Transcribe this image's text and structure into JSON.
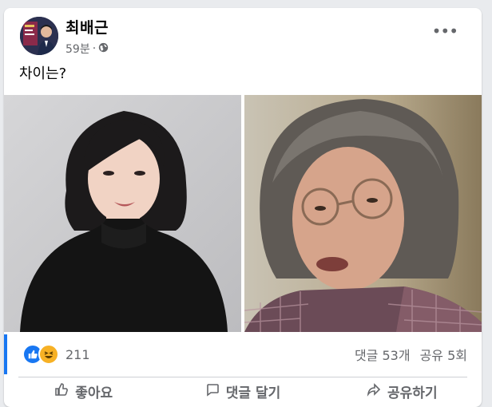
{
  "post": {
    "author_name": "최배근",
    "timestamp": "59분",
    "separator": "·",
    "audience_icon": "globe-icon",
    "text": "차이는?",
    "more_icon": "more-options-icon"
  },
  "media": {
    "left_photo": "portrait-woman-short-bob",
    "right_photo": "portrait-woman-gray-hair-glasses"
  },
  "engagement": {
    "reaction_icons": [
      "like-icon",
      "haha-icon"
    ],
    "reaction_count": "211",
    "comments": "댓글 53개",
    "shares": "공유 5회"
  },
  "actions": {
    "like_label": "좋아요",
    "comment_label": "댓글 달기",
    "share_label": "공유하기"
  },
  "colors": {
    "accent": "#1877f2",
    "secondary_text": "#65676b",
    "haha": "#f7b125"
  }
}
